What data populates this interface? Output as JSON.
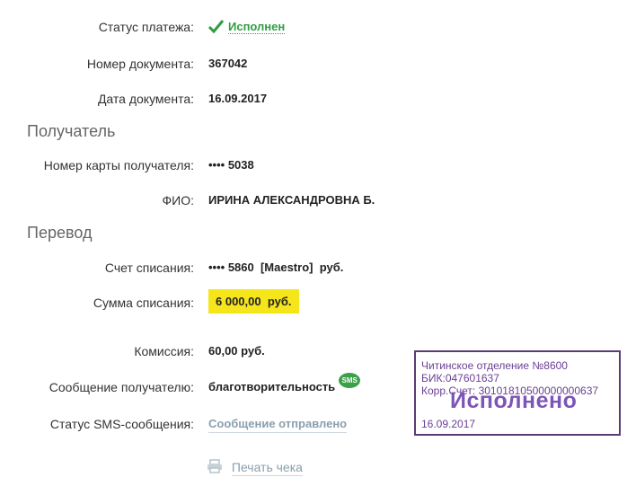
{
  "payment": {
    "status_label": "Статус платежа:",
    "status_value": "Исполнен",
    "doc_number_label": "Номер документа:",
    "doc_number_value": "367042",
    "doc_date_label": "Дата документа:",
    "doc_date_value": "16.09.2017"
  },
  "recipient": {
    "section_title": "Получатель",
    "card_label": "Номер карты получателя:",
    "card_value": "•••• 5038",
    "name_label": "ФИО:",
    "name_value": "ИРИНА АЛЕКСАНДРОВНА Б."
  },
  "transfer": {
    "section_title": "Перевод",
    "account_label": "Счет списания:",
    "account_value": "•••• 5860  [Maestro]  руб.",
    "amount_label": "Сумма списания:",
    "amount_value": "6 000,00  руб.",
    "fee_label": "Комиссия:",
    "fee_value": "60,00 руб.",
    "message_label": "Сообщение получателю:",
    "message_value": "благотворительность",
    "sms_badge": "SMS",
    "sms_status_label": "Статус SMS-сообщения:",
    "sms_status_value": "Сообщение отправлено"
  },
  "actions": {
    "print_label": "Печать чека"
  },
  "stamp": {
    "line1": "Читинское отделение №8600",
    "line2": "БИК:047601637",
    "line3": "Корр.Счет: 30101810500000000637",
    "big_text": "Исполнено",
    "date": "16.09.2017"
  },
  "colors": {
    "status_green": "#2f9e41",
    "highlight_yellow": "#f5e51b",
    "stamp_purple": "#6a3f95",
    "link_gray": "#8a9fae"
  }
}
